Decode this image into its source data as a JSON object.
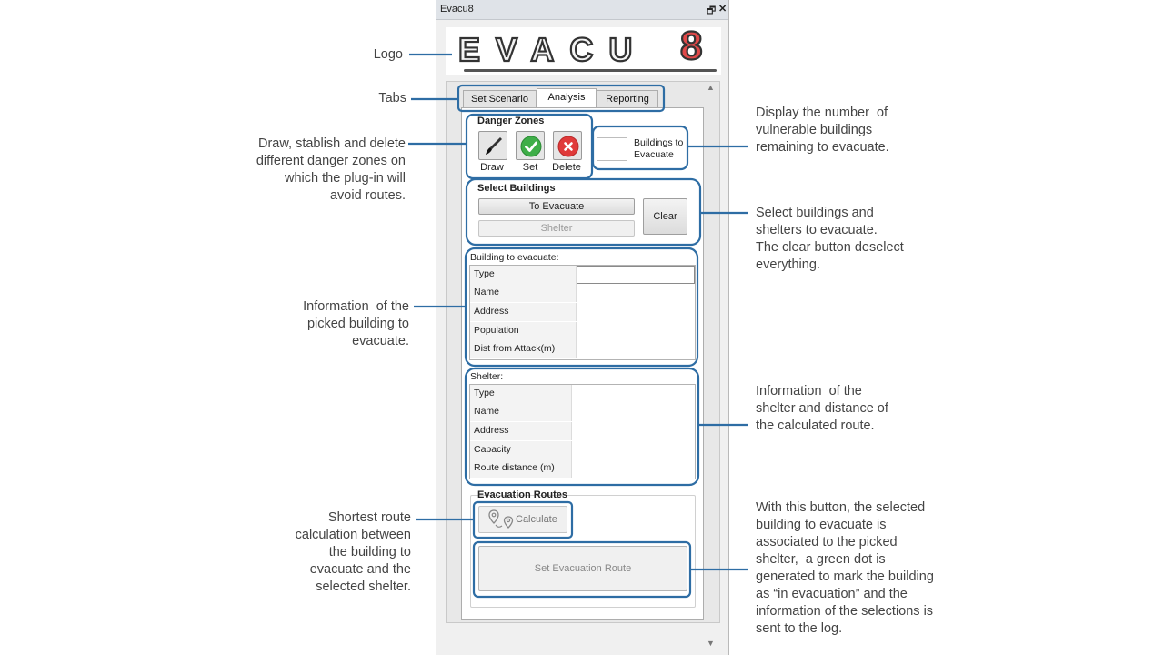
{
  "window": {
    "title": "Evacu8",
    "restore_icon": "restore-window-icon",
    "close_icon": "close-icon"
  },
  "logo": {
    "letters": "EVACU",
    "digit": "8",
    "digit_color": "#e04848"
  },
  "tabs": [
    {
      "label": "Set Scenario",
      "active": false
    },
    {
      "label": "Analysis",
      "active": true
    },
    {
      "label": "Reporting",
      "active": false
    }
  ],
  "danger_zones": {
    "title": "Danger Zones",
    "draw": {
      "label": "Draw",
      "icon": "brush-icon"
    },
    "set": {
      "label": "Set",
      "icon": "check-icon",
      "color": "#3fae49"
    },
    "delete": {
      "label": "Delete",
      "icon": "delete-x-icon",
      "color": "#e03a3a"
    }
  },
  "buildings_counter": {
    "value": "",
    "label_line1": "Buildings to",
    "label_line2": "Evacuate"
  },
  "select_buildings": {
    "title": "Select Buildings",
    "to_evacuate": "To Evacuate",
    "shelter": "Shelter",
    "clear": "Clear"
  },
  "building_info": {
    "title": "Building to evacuate:",
    "rows": [
      {
        "field": "Type",
        "value": ""
      },
      {
        "field": "Name",
        "value": ""
      },
      {
        "field": "Address",
        "value": ""
      },
      {
        "field": "Population",
        "value": ""
      },
      {
        "field": "Dist from Attack(m)",
        "value": ""
      }
    ]
  },
  "shelter_info": {
    "title": "Shelter:",
    "rows": [
      {
        "field": "Type",
        "value": ""
      },
      {
        "field": "Name",
        "value": ""
      },
      {
        "field": "Address",
        "value": ""
      },
      {
        "field": "Capacity",
        "value": ""
      },
      {
        "field": "Route distance (m)",
        "value": ""
      }
    ]
  },
  "evacuation_routes": {
    "title": "Evacuation Routes",
    "calculate": "Calculate",
    "calculate_icon": "route-pins-icon",
    "set_route": "Set Evacuation Route"
  },
  "callouts": {
    "logo": "Logo",
    "tabs": "Tabs",
    "danger": [
      "Draw, stablish and delete",
      "different danger zones on",
      "which the plug-in will",
      "avoid routes."
    ],
    "counter": [
      "Display the number  of",
      "vulnerable buildings",
      "remaining to evacuate."
    ],
    "select": [
      "Select buildings and",
      "shelters to evacuate.",
      "The clear button deselect",
      "everything."
    ],
    "building": [
      "Information  of the",
      "picked building to",
      "evacuate."
    ],
    "shelter": [
      "Information  of the",
      "shelter and distance of",
      "the calculated route."
    ],
    "calculate": [
      "Shortest route",
      "calculation between",
      "the building to",
      "evacuate and the",
      "selected shelter."
    ],
    "set_route": [
      "With this button, the selected",
      "building to evacuate is",
      "associated to the picked",
      "shelter,  a green dot is",
      "generated to mark the building",
      "as “in evacuation” and the",
      "information of the selections is",
      "sent to the log."
    ]
  },
  "colors": {
    "callout_line": "#2e6da4",
    "callout_text": "#444444"
  }
}
